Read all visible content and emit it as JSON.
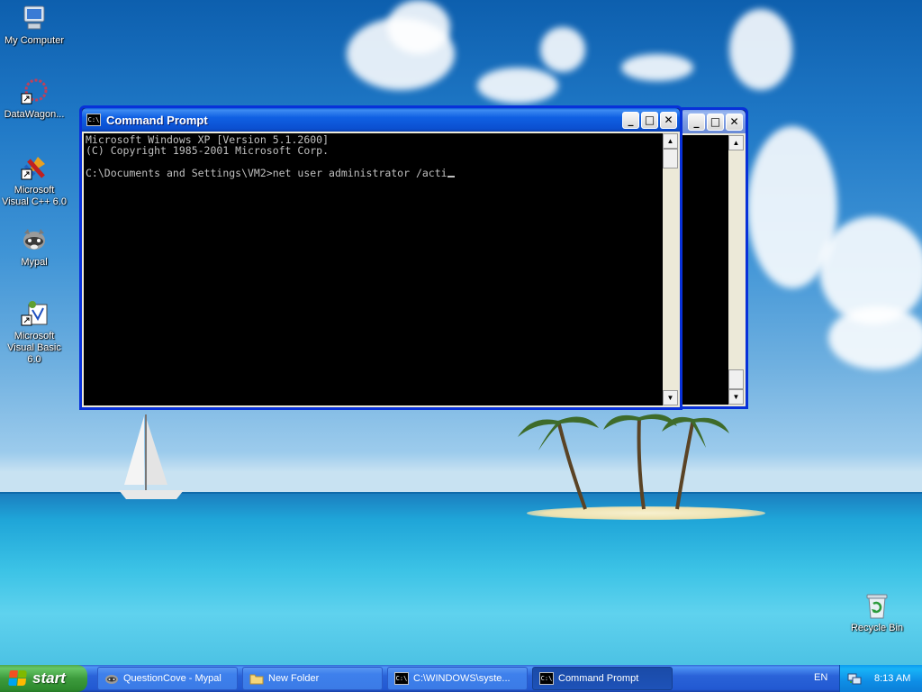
{
  "desktop": {
    "icons": [
      {
        "label": "My Computer",
        "icon": "my-computer-icon"
      },
      {
        "label": "DataWagon...",
        "icon": "datawagon-icon"
      },
      {
        "label": "Microsoft Visual C++ 6.0",
        "icon": "visual-cpp-icon"
      },
      {
        "label": "Mypal",
        "icon": "mypal-raccoon-icon"
      },
      {
        "label": "Microsoft Visual Basic 6.0",
        "icon": "visual-basic-icon"
      },
      {
        "label": "Recycle Bin",
        "icon": "recycle-bin-icon"
      }
    ]
  },
  "windows": {
    "command_prompt": {
      "title": "Command Prompt",
      "lines": [
        "Microsoft Windows XP [Version 5.1.2600]",
        "(C) Copyright 1985-2001 Microsoft Corp.",
        "",
        "C:\\Documents and Settings\\VM2>net user administrator /acti"
      ]
    },
    "background_console": {
      "title": ""
    }
  },
  "taskbar": {
    "start_label": "start",
    "tasks": [
      {
        "label": "QuestionCove - Mypal",
        "icon": "mypal-raccoon-icon",
        "active": false
      },
      {
        "label": "New Folder",
        "icon": "folder-icon",
        "active": false
      },
      {
        "label": "C:\\WINDOWS\\syste...",
        "icon": "console-icon",
        "active": false
      },
      {
        "label": "Command Prompt",
        "icon": "console-icon",
        "active": true
      }
    ],
    "language": "EN",
    "clock": "8:13 AM"
  },
  "colors": {
    "console_background": "#000000",
    "console_text": "#c0c0c0",
    "titlebar_active": "#0b4fd0",
    "start_button": "#3d9b3d",
    "taskbar": "#2a63d8"
  }
}
